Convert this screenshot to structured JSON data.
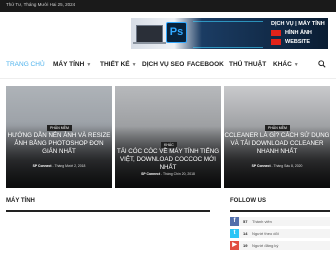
{
  "topbar": {
    "date": "Thứ Tư, Tháng Mười Hai 25, 2024"
  },
  "banner": {
    "logo_text": "Ps",
    "line1": "DỊCH VỤ",
    "line1b": "MÁY TÍNH",
    "line2": "HÌNH ẢNH",
    "line3": "WEBSITE",
    "colors": {
      "accent": "#e2231a",
      "brand": "#31a8ff"
    }
  },
  "nav": {
    "items": [
      {
        "label": "TRANG CHỦ",
        "active": true
      },
      {
        "label": "MÁY TÍNH",
        "dropdown": true
      },
      {
        "label": "THIẾT KẾ",
        "dropdown": true
      },
      {
        "label": "DỊCH VỤ SEO"
      },
      {
        "label": "FACEBOOK"
      },
      {
        "label": "THỦ THUẬT"
      },
      {
        "label": "KHÁC",
        "dropdown": true
      }
    ],
    "search_icon": "search-icon",
    "active_color": "#4db2ec"
  },
  "cards": [
    {
      "category": "PHẦN MỀM",
      "title": "HƯỚNG DẪN NÉN ẢNH VÀ RESIZE ẢNH BẰNG PHOTOSHOP ĐƠN GIẢN NHẤT",
      "author": "SP Connect",
      "date": "Tháng Mười 2, 2018"
    },
    {
      "category": "KHÁC",
      "title": "TẢI CÓC CÓC VỀ MÁY TÍNH TIẾNG VIỆT, DOWNLOAD COCCOC MỚI NHẤT",
      "author": "SP Connect",
      "date": "Tháng Chín 20, 2018"
    },
    {
      "category": "PHẦN MỀM",
      "title": "CCLEANER LÀ GÌ? CÁCH SỬ DỤNG VÀ TẢI DOWNLOAD CCLEANER NHANH NHẤT",
      "author": "SP Connect",
      "date": "Tháng Sáu 8, 2020"
    }
  ],
  "sections": {
    "left": "MÁY TÍNH",
    "right": "FOLLOW US"
  },
  "follow": [
    {
      "icon": "facebook-icon",
      "count": "57",
      "action": "Thành viên"
    },
    {
      "icon": "twitter-icon",
      "count": "14",
      "action": "Người theo dõi"
    },
    {
      "icon": "youtube-icon",
      "count": "19",
      "action": "Người đăng ký"
    }
  ]
}
